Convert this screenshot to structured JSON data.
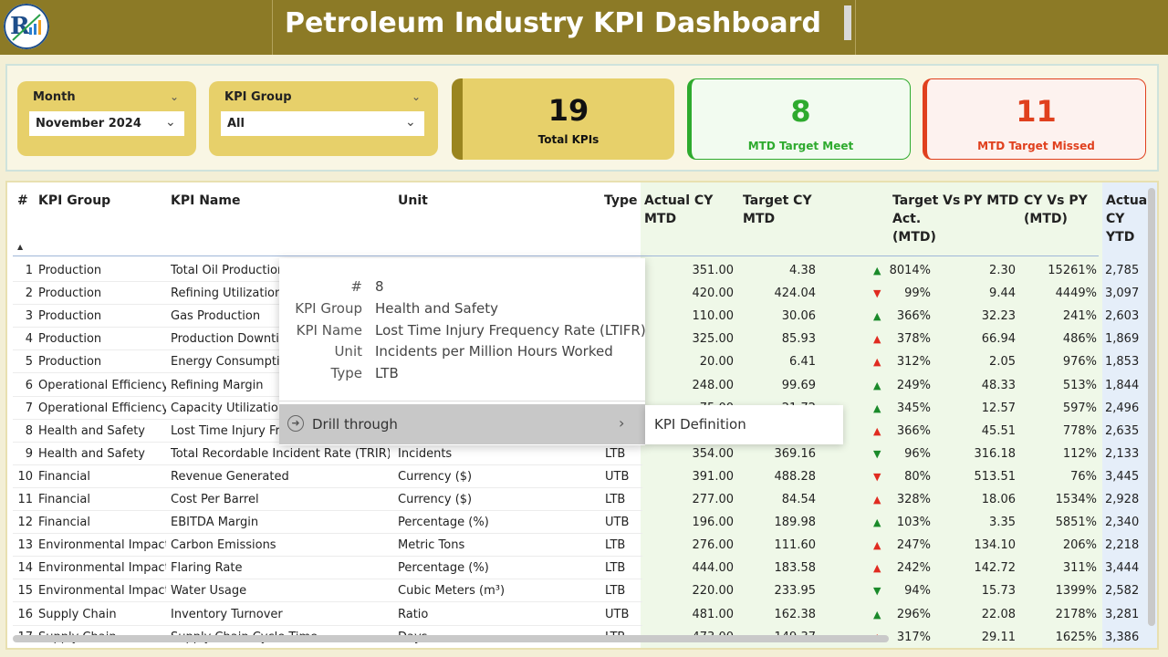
{
  "header": {
    "title": "Petroleum Industry KPI Dashboard",
    "logo_icon": "analytics-logo-icon"
  },
  "filters": {
    "month": {
      "label": "Month",
      "value": "November 2024"
    },
    "kpi_group": {
      "label": "KPI Group",
      "value": "All"
    }
  },
  "cards": {
    "total": {
      "value": "19",
      "label": "Total KPIs",
      "color": "#9a8520"
    },
    "meet": {
      "value": "8",
      "label": "MTD Target Meet",
      "color": "#2eaa2e"
    },
    "missed": {
      "value": "11",
      "label": "MTD Target Missed",
      "color": "#e0401e"
    }
  },
  "table": {
    "headers": {
      "num": "#",
      "group": "KPI Group",
      "name": "KPI Name",
      "unit": "Unit",
      "type": "Type",
      "actual_mtd": [
        "Actual CY",
        "MTD"
      ],
      "target_mtd": [
        "Target CY",
        "MTD"
      ],
      "tva": [
        "Target Vs",
        "Act.",
        "(MTD)"
      ],
      "py_mtd": "PY MTD",
      "cy_py": [
        "CY Vs PY",
        "(MTD)"
      ],
      "actual_ytd": [
        "Actual",
        "CY YTD"
      ]
    },
    "rows": [
      {
        "num": "1",
        "group": "Production",
        "name": "Total Oil Production",
        "unit": "",
        "type": "",
        "actual": "351.00",
        "target": "4.38",
        "arrow": "up",
        "tva": "8014%",
        "py": "2.30",
        "cypy": "15261%",
        "ytd": "2,785"
      },
      {
        "num": "2",
        "group": "Production",
        "name": "Refining Utilization",
        "unit": "",
        "type": "",
        "actual": "420.00",
        "target": "424.04",
        "arrow": "down-red",
        "tva": "99%",
        "py": "9.44",
        "cypy": "4449%",
        "ytd": "3,097"
      },
      {
        "num": "3",
        "group": "Production",
        "name": "Gas Production",
        "unit": "",
        "type": "",
        "actual": "110.00",
        "target": "30.06",
        "arrow": "up",
        "tva": "366%",
        "py": "32.23",
        "cypy": "241%",
        "ytd": "2,603"
      },
      {
        "num": "4",
        "group": "Production",
        "name": "Production Downtime",
        "unit": "",
        "type": "",
        "actual": "325.00",
        "target": "85.93",
        "arrow": "up-red",
        "tva": "378%",
        "py": "66.94",
        "cypy": "486%",
        "ytd": "1,869"
      },
      {
        "num": "5",
        "group": "Production",
        "name": "Energy Consumption",
        "unit": "",
        "type": "",
        "actual": "20.00",
        "target": "6.41",
        "arrow": "up-red",
        "tva": "312%",
        "py": "2.05",
        "cypy": "976%",
        "ytd": "1,853"
      },
      {
        "num": "6",
        "group": "Operational Efficiency",
        "name": "Refining Margin",
        "unit": "",
        "type": "",
        "actual": "248.00",
        "target": "99.69",
        "arrow": "up",
        "tva": "249%",
        "py": "48.33",
        "cypy": "513%",
        "ytd": "1,844"
      },
      {
        "num": "7",
        "group": "Operational Efficiency",
        "name": "Capacity Utilization",
        "unit": "",
        "type": "",
        "actual": "75.00",
        "target": "21.72",
        "arrow": "up",
        "tva": "345%",
        "py": "12.57",
        "cypy": "597%",
        "ytd": "2,496"
      },
      {
        "num": "8",
        "group": "Health and Safety",
        "name": "Lost Time Injury Fr...",
        "unit": "",
        "type": "",
        "actual": "",
        "target": "",
        "arrow": "up-red",
        "tva": "366%",
        "py": "45.51",
        "cypy": "778%",
        "ytd": "2,635"
      },
      {
        "num": "9",
        "group": "Health and Safety",
        "name": "Total Recordable Incident Rate (TRIR)",
        "unit": "Incidents",
        "type": "LTB",
        "actual": "354.00",
        "target": "369.16",
        "arrow": "down",
        "tva": "96%",
        "py": "316.18",
        "cypy": "112%",
        "ytd": "2,133"
      },
      {
        "num": "10",
        "group": "Financial",
        "name": "Revenue Generated",
        "unit": "Currency ($)",
        "type": "UTB",
        "actual": "391.00",
        "target": "488.28",
        "arrow": "down-red",
        "tva": "80%",
        "py": "513.51",
        "cypy": "76%",
        "ytd": "3,445"
      },
      {
        "num": "11",
        "group": "Financial",
        "name": "Cost Per Barrel",
        "unit": "Currency ($)",
        "type": "LTB",
        "actual": "277.00",
        "target": "84.54",
        "arrow": "up-red",
        "tva": "328%",
        "py": "18.06",
        "cypy": "1534%",
        "ytd": "2,928"
      },
      {
        "num": "12",
        "group": "Financial",
        "name": "EBITDA Margin",
        "unit": "Percentage (%)",
        "type": "UTB",
        "actual": "196.00",
        "target": "189.98",
        "arrow": "up",
        "tva": "103%",
        "py": "3.35",
        "cypy": "5851%",
        "ytd": "2,340"
      },
      {
        "num": "13",
        "group": "Environmental Impact",
        "name": "Carbon Emissions",
        "unit": "Metric Tons",
        "type": "LTB",
        "actual": "276.00",
        "target": "111.60",
        "arrow": "up-red",
        "tva": "247%",
        "py": "134.10",
        "cypy": "206%",
        "ytd": "2,218"
      },
      {
        "num": "14",
        "group": "Environmental Impact",
        "name": "Flaring Rate",
        "unit": "Percentage (%)",
        "type": "LTB",
        "actual": "444.00",
        "target": "183.58",
        "arrow": "up-red",
        "tva": "242%",
        "py": "142.72",
        "cypy": "311%",
        "ytd": "3,444"
      },
      {
        "num": "15",
        "group": "Environmental Impact",
        "name": "Water Usage",
        "unit": "Cubic Meters (m³)",
        "type": "LTB",
        "actual": "220.00",
        "target": "233.95",
        "arrow": "down",
        "tva": "94%",
        "py": "15.73",
        "cypy": "1399%",
        "ytd": "2,582"
      },
      {
        "num": "16",
        "group": "Supply Chain",
        "name": "Inventory Turnover",
        "unit": "Ratio",
        "type": "UTB",
        "actual": "481.00",
        "target": "162.38",
        "arrow": "up",
        "tva": "296%",
        "py": "22.08",
        "cypy": "2178%",
        "ytd": "3,281"
      },
      {
        "num": "17",
        "group": "Supply Chain",
        "name": "Supply Chain Cycle Time",
        "unit": "Days",
        "type": "LTB",
        "actual": "473.00",
        "target": "149.37",
        "arrow": "up-red",
        "tva": "317%",
        "py": "29.11",
        "cypy": "1625%",
        "ytd": "3,386"
      }
    ]
  },
  "tooltip": {
    "fields": [
      {
        "key": "#",
        "value": "8"
      },
      {
        "key": "KPI Group",
        "value": "Health and Safety"
      },
      {
        "key": "KPI Name",
        "value": "Lost Time Injury Frequency Rate (LTIFR)"
      },
      {
        "key": "Unit",
        "value": "Incidents per Million Hours Worked"
      },
      {
        "key": "Type",
        "value": "LTB"
      }
    ],
    "drill_label": "Drill through",
    "submenu_item": "KPI Definition"
  }
}
